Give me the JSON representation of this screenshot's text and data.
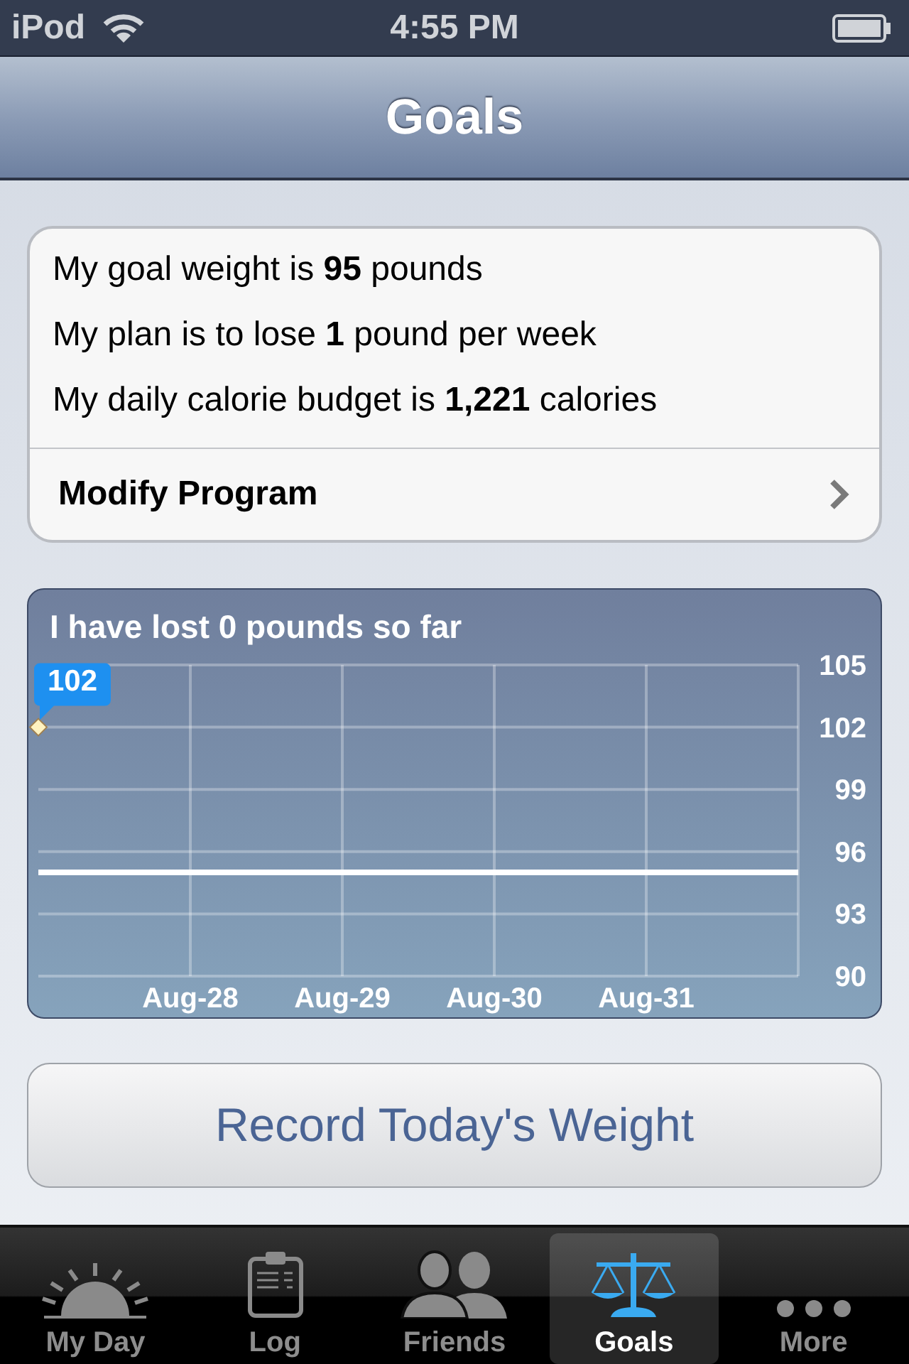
{
  "status_bar": {
    "carrier": "iPod",
    "time": "4:55 PM"
  },
  "nav_bar": {
    "title": "Goals"
  },
  "summary": {
    "lines": [
      "My goal weight is **95** pounds",
      "My plan is to lose **1** pound per week",
      "My daily calorie budget is **1,221** calories"
    ],
    "action": "Modify Program"
  },
  "progress": {
    "title": "I have lost 0 pounds so far",
    "chart_data": {
      "type": "line",
      "categories": [
        null,
        "Aug-28",
        "Aug-29",
        "Aug-30",
        "Aug-31",
        null
      ],
      "ylim": [
        90,
        105
      ],
      "yticks": [
        90,
        93,
        96,
        99,
        102,
        105
      ],
      "series": [
        {
          "color": "#fff2c0",
          "marker": "diamond",
          "values": [
            102,
            null,
            null,
            null,
            null,
            null
          ]
        },
        {
          "color": "#ffffff",
          "values": [
            95,
            95,
            95,
            95,
            95,
            95
          ]
        }
      ],
      "annotations": [
        "102"
      ]
    }
  },
  "record_button": "Record Today's Weight",
  "tabs": [
    {
      "label": "My Day",
      "selected": false
    },
    {
      "label": "Log",
      "selected": false
    },
    {
      "label": "Friends",
      "selected": false
    },
    {
      "label": "Goals",
      "selected": true
    },
    {
      "label": "More",
      "selected": false
    }
  ]
}
